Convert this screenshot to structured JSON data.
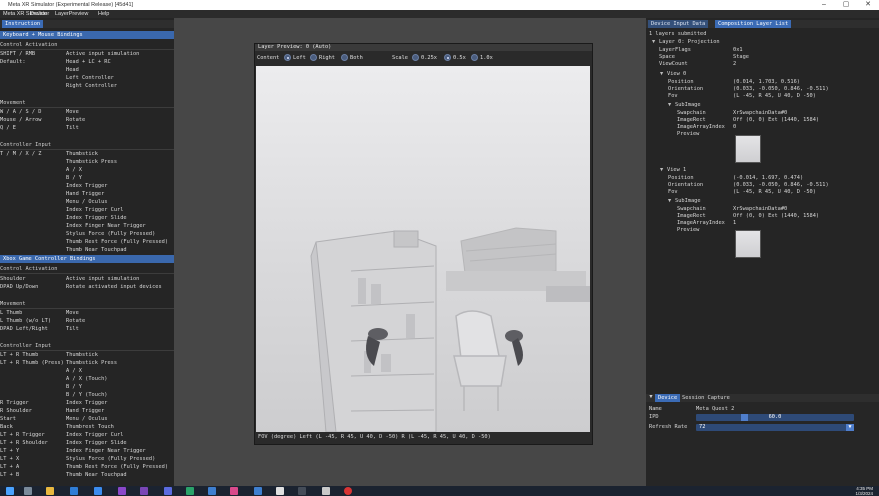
{
  "window": {
    "title": "Meta XR Simulator (Experimental Release) [45d41]",
    "controls": [
      "–",
      "▢",
      "✕"
    ]
  },
  "menu": [
    "Meta XR Simulator",
    "Device",
    "LayerPreview",
    "Help"
  ],
  "left": {
    "tab": "Instruction",
    "kb_header": "Keyboard + Mouse Bindings",
    "kb_col1": "Control Activation",
    "kb_col1_rows": [
      {
        "k": "SHIFT / RMB",
        "v": "Active input simulation"
      },
      {
        "k": "Default:",
        "v": "Head + LC + RC"
      },
      {
        "k": "",
        "v": "Head"
      },
      {
        "k": "",
        "v": "Left Controller"
      },
      {
        "k": "",
        "v": "Right Controller"
      }
    ],
    "movement_label": "Movement",
    "movement_rows": [
      {
        "k": "W / A / S / D",
        "v": "Move"
      },
      {
        "k": "Mouse / Arrow",
        "v": "Rotate"
      },
      {
        "k": "Q / E",
        "v": "Tilt"
      }
    ],
    "ctrl_label": "Controller Input",
    "ctrl_rows": [
      {
        "k": "T / M / X / Z",
        "v": "Thumbstick"
      },
      {
        "k": "",
        "v": "Thumbstick Press"
      },
      {
        "k": "",
        "v": "A / X"
      },
      {
        "k": "",
        "v": "B / Y"
      },
      {
        "k": "",
        "v": "Index Trigger"
      },
      {
        "k": "",
        "v": "Hand Trigger"
      },
      {
        "k": "",
        "v": "Menu / Oculus"
      },
      {
        "k": "",
        "v": "Index Trigger Curl"
      },
      {
        "k": "",
        "v": "Index Trigger Slide"
      },
      {
        "k": "",
        "v": "Index Finger Near Trigger"
      },
      {
        "k": "",
        "v": "Stylus Force (Fully Pressed)"
      },
      {
        "k": "",
        "v": "Thumb Rest Force (Fully Pressed)"
      },
      {
        "k": "",
        "v": "Thumb Near Touchpad"
      }
    ],
    "gp_header": "Xbox Game Controller Bindings",
    "gp_col1": "Control Activation",
    "gp_act_rows": [
      {
        "k": "Shoulder",
        "v": "Active input simulation"
      },
      {
        "k": "DPAD Up/Down",
        "v": "Rotate activated input devices"
      }
    ],
    "gp_movement_label": "Movement",
    "gp_movement_rows": [
      {
        "k": "L Thumb",
        "v": "Move"
      },
      {
        "k": "L Thumb (w/o LT)",
        "v": "Rotate"
      },
      {
        "k": "DPAD Left/Right",
        "v": "Tilt"
      }
    ],
    "gp_ctrl_label": "Controller Input",
    "gp_ctrl_rows": [
      {
        "k": "LT + R Thumb",
        "v": "Thumbstick"
      },
      {
        "k": "LT + R Thumb (Press)",
        "v": "Thumbstick Press"
      },
      {
        "k": "",
        "v": "A / X"
      },
      {
        "k": "",
        "v": "A / X (Touch)"
      },
      {
        "k": "",
        "v": "B / Y"
      },
      {
        "k": "",
        "v": "B / Y (Touch)"
      },
      {
        "k": "R Trigger",
        "v": "Index Trigger"
      },
      {
        "k": "R Shoulder",
        "v": "Hand Trigger"
      },
      {
        "k": "Start",
        "v": "Menu / Oculus"
      },
      {
        "k": "Back",
        "v": "Thumbrest Touch"
      },
      {
        "k": "LT + R Trigger",
        "v": "Index Trigger Curl"
      },
      {
        "k": "LT + R Shoulder",
        "v": "Index Trigger Slide"
      },
      {
        "k": "LT + Y",
        "v": "Index Finger Near Trigger"
      },
      {
        "k": "LT + X",
        "v": "Stylus Force (Fully Pressed)"
      },
      {
        "k": "LT + A",
        "v": "Thumb Rest Force (Fully Pressed)"
      },
      {
        "k": "LT + B",
        "v": "Thumb Near Touchpad"
      }
    ]
  },
  "preview": {
    "title": "Layer Preview: 0 (Auto)",
    "content_label": "Content",
    "eye_options": [
      "Left",
      "Right",
      "Both"
    ],
    "eye_selected": "Left",
    "scale_label": "Scale",
    "scale_options": [
      "0.25x",
      "0.5x",
      "1.0x"
    ],
    "scale_selected": "0.5x",
    "fov_text": "FOV (degree)  Left (L -45, R 45, U 40, D -50) R (L -45, R 45, U 40, D -50)"
  },
  "right": {
    "tabs": [
      "Device Input Data",
      "Composition Layer List"
    ],
    "active_tab": "Composition Layer List",
    "layers_summary": "1 layers submitted",
    "layer_title": "Layer 0: Projection",
    "layer_props": [
      {
        "k": "LayerFlags",
        "v": "0x1"
      },
      {
        "k": "Space",
        "v": "Stage"
      },
      {
        "k": "ViewCount",
        "v": "2"
      }
    ],
    "view0_title": "View 0",
    "view0_props": [
      {
        "k": "Position",
        "v": "(0.014, 1.703, 0.516)"
      },
      {
        "k": "Orientation",
        "v": "(0.033, -0.050, 0.846, -0.511)"
      },
      {
        "k": "Fov",
        "v": "(L -45, R 45, U 40, D -50)"
      }
    ],
    "subimage_title": "SubImage",
    "sub0_props": [
      {
        "k": "Swapchain",
        "v": "XrSwapchainData#0"
      },
      {
        "k": "ImageRect",
        "v": "Off (0, 0) Ext (1440, 1584)"
      },
      {
        "k": "ImageArrayIndex",
        "v": "0"
      },
      {
        "k": "Preview",
        "v": ""
      }
    ],
    "view1_title": "View 1",
    "view1_props": [
      {
        "k": "Position",
        "v": "(-0.014, 1.697, 0.474)"
      },
      {
        "k": "Orientation",
        "v": "(0.033, -0.050, 0.846, -0.511)"
      },
      {
        "k": "Fov",
        "v": "(L -45, R 45, U 40, D -50)"
      }
    ],
    "sub1_props": [
      {
        "k": "Swapchain",
        "v": "XrSwapchainData#0"
      },
      {
        "k": "ImageRect",
        "v": "Off (0, 0) Ext (1440, 1584)"
      },
      {
        "k": "ImageArrayIndex",
        "v": "1"
      },
      {
        "k": "Preview",
        "v": ""
      }
    ]
  },
  "device": {
    "tabs": [
      "Device",
      "Session Capture"
    ],
    "active_tab": "Device",
    "name_label": "Name",
    "name_value": "Meta Quest 2",
    "ipd_label": "IPD",
    "ipd_value": "60.0",
    "ipd_fraction": 0.3,
    "refresh_label": "Refresh Rate",
    "refresh_value": "72"
  },
  "taskbar": {
    "time": "4:35 PM",
    "date": "1/3/2024"
  },
  "colors": {
    "header_blue": "#3a68ad",
    "tab_blue": "#3b6bb5",
    "panel_bg": "#252525",
    "desktop_bg": "#474747"
  }
}
